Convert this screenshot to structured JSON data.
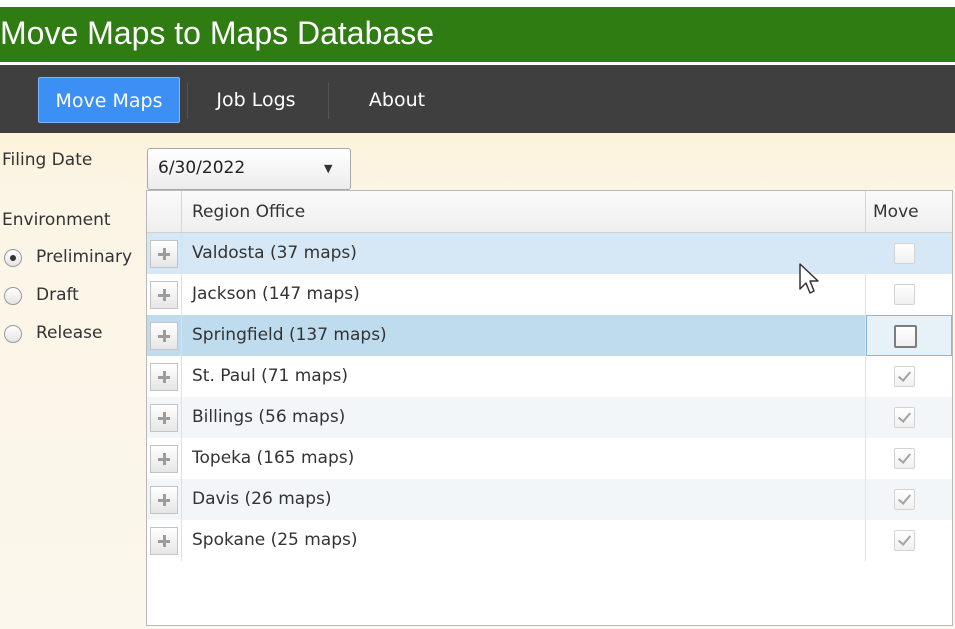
{
  "window": {
    "title": "Move Maps to Maps Database"
  },
  "nav": {
    "tabs": [
      {
        "label": "Move Maps",
        "active": true
      },
      {
        "label": "Job Logs",
        "active": false
      },
      {
        "label": "About",
        "active": false
      }
    ]
  },
  "filters": {
    "filing_date_label": "Filing Date",
    "filing_date_value": "6/30/2022",
    "environment_label": "Environment",
    "environment_options": [
      {
        "label": "Preliminary",
        "selected": true
      },
      {
        "label": "Draft",
        "selected": false
      },
      {
        "label": "Release",
        "selected": false
      }
    ]
  },
  "grid": {
    "columns": {
      "region": "Region Office",
      "move": "Move"
    },
    "rows": [
      {
        "region": "Valdosta (37 maps)",
        "move": false
      },
      {
        "region": "Jackson (147 maps)",
        "move": false
      },
      {
        "region": "Springfield (137 maps)",
        "move": false
      },
      {
        "region": "St. Paul (71 maps)",
        "move": true
      },
      {
        "region": "Billings (56 maps)",
        "move": true
      },
      {
        "region": "Topeka (165 maps)",
        "move": true
      },
      {
        "region": "Davis (26 maps)",
        "move": true
      },
      {
        "region": "Spokane (25 maps)",
        "move": true
      }
    ]
  },
  "colors": {
    "title_bar": "#2f7d12",
    "nav_bar": "#3f3f3f",
    "active_tab": "#3b8ff5",
    "selected_row": "#bfdcee"
  },
  "icons": {
    "expander": "plus-icon",
    "dropdown": "triangle-down-icon",
    "pointer": "mouse-cursor-icon"
  }
}
